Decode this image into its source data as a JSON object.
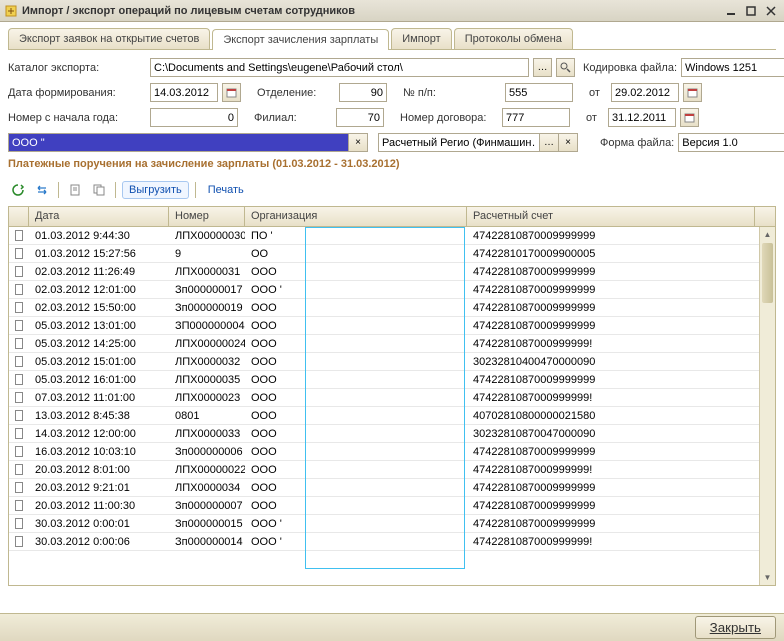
{
  "window": {
    "title": "Импорт / экспорт операций по лицевым счетам сотрудников"
  },
  "tabs": [
    {
      "label": "Экспорт заявок на открытие счетов"
    },
    {
      "label": "Экспорт зачисления зарплаты"
    },
    {
      "label": "Импорт"
    },
    {
      "label": "Протоколы обмена"
    }
  ],
  "form": {
    "catalog_label": "Каталог экспорта:",
    "catalog_value": "C:\\Documents and Settings\\eugene\\Рабочий стол\\",
    "encoding_label": "Кодировка файла:",
    "encoding_value": "Windows 1251",
    "date_form_label": "Дата формирования:",
    "date_form_value": "14.03.2012",
    "department_label": "Отделение:",
    "department_value": "90",
    "npp_label": "№ п/п:",
    "npp_value": "555",
    "from1_label": "от",
    "from1_value": "29.02.2012",
    "year_num_label": "Номер с начала года:",
    "year_num_value": "0",
    "branch_label": "Филиал:",
    "branch_value": "70",
    "contract_label": "Номер договора:",
    "contract_value": "777",
    "from2_label": "от",
    "from2_value": "31.12.2011",
    "org_value": "ООО \"",
    "region_value": "Расчетный Регио (Финмашин…",
    "file_form_label": "Форма файла:",
    "file_form_value": "Версия 1.0"
  },
  "section_title": "Платежные поручения на зачисление зарплаты (01.03.2012 - 31.03.2012)",
  "toolbar": {
    "export_label": "Выгрузить",
    "print_label": "Печать"
  },
  "table": {
    "headers": {
      "date": "Дата",
      "number": "Номер",
      "org": "Организация",
      "account": "Расчетный счет"
    },
    "rows": [
      {
        "date": "01.03.2012 9:44:30",
        "num": "ЛПХ00000030",
        "org": "ПО '",
        "acc": "47422810870009999999"
      },
      {
        "date": "01.03.2012 15:27:56",
        "num": "9",
        "org": "ОО",
        "acc": "47422810170009900005"
      },
      {
        "date": "02.03.2012 11:26:49",
        "num": "ЛПХ0000031",
        "org": "ООО",
        "acc": "47422810870009999999"
      },
      {
        "date": "02.03.2012 12:01:00",
        "num": "Зп000000017",
        "org": "ООО '",
        "acc": "47422810870009999999"
      },
      {
        "date": "02.03.2012 15:50:00",
        "num": "Зп000000019",
        "org": "ООО",
        "acc": "47422810870009999999"
      },
      {
        "date": "05.03.2012 13:01:00",
        "num": "ЗП000000004",
        "org": "ООО",
        "acc": "47422810870009999999"
      },
      {
        "date": "05.03.2012 14:25:00",
        "num": "ЛПХ00000024",
        "org": "ООО",
        "acc": "4742281087000999999!"
      },
      {
        "date": "05.03.2012 15:01:00",
        "num": "ЛПХ0000032",
        "org": "ООО",
        "acc": "30232810400470000090"
      },
      {
        "date": "05.03.2012 16:01:00",
        "num": "ЛПХ0000035",
        "org": "ООО",
        "acc": "47422810870009999999"
      },
      {
        "date": "07.03.2012 11:01:00",
        "num": "ЛПХ0000023",
        "org": "ООО",
        "acc": "4742281087000999999!"
      },
      {
        "date": "13.03.2012 8:45:38",
        "num": "0801",
        "org": "ООО",
        "acc": "40702810800000021580"
      },
      {
        "date": "14.03.2012 12:00:00",
        "num": "ЛПХ0000033",
        "org": "ООО",
        "acc": "30232810870047000090"
      },
      {
        "date": "16.03.2012 10:03:10",
        "num": "Зп000000006",
        "org": "ООО",
        "acc": "47422810870009999999"
      },
      {
        "date": "20.03.2012 8:01:00",
        "num": "ЛПХ00000022",
        "org": "ООО",
        "acc": "4742281087000999999!"
      },
      {
        "date": "20.03.2012 9:21:01",
        "num": "ЛПХ0000034",
        "org": "ООО",
        "acc": "47422810870009999999"
      },
      {
        "date": "20.03.2012 11:00:30",
        "num": "Зп000000007",
        "org": "ООО",
        "acc": "47422810870009999999"
      },
      {
        "date": "30.03.2012 0:00:01",
        "num": "Зп000000015",
        "org": "ООО '",
        "acc": "47422810870009999999"
      },
      {
        "date": "30.03.2012 0:00:06",
        "num": "Зп000000014",
        "org": "ООО '",
        "acc": "4742281087000999999!"
      }
    ]
  },
  "bottom": {
    "close_label": "Закрыть"
  }
}
